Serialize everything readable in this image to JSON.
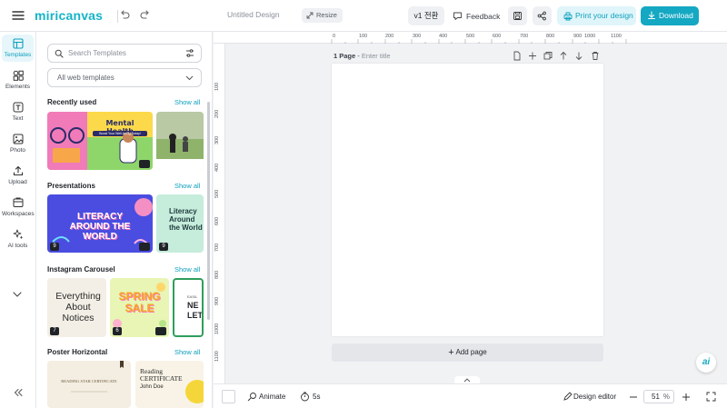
{
  "topbar": {
    "logo": "miricanvas",
    "title": "Untitled Design",
    "resize": "Resize",
    "version": "v1 전환",
    "feedback": "Feedback",
    "print": "Print your design",
    "download": "Download"
  },
  "rail": {
    "items": [
      {
        "label": "Templates",
        "icon": "templates-icon"
      },
      {
        "label": "Elements",
        "icon": "elements-icon"
      },
      {
        "label": "Text",
        "icon": "text-icon"
      },
      {
        "label": "Photo",
        "icon": "photo-icon"
      },
      {
        "label": "Upload",
        "icon": "upload-icon"
      },
      {
        "label": "Workspaces",
        "icon": "workspaces-icon"
      },
      {
        "label": "AI tools",
        "icon": "ai-tools-icon"
      }
    ]
  },
  "panel": {
    "search_placeholder": "Search Templates",
    "filter_value": "All web templates",
    "sections": [
      {
        "title": "Recently used",
        "show_all": "Show all",
        "thumbs": [
          {
            "title": "Mental Health",
            "subtitle": "Boost Your Well-being Today!"
          },
          {
            "title": ""
          }
        ]
      },
      {
        "title": "Presentations",
        "show_all": "Show all",
        "thumbs": [
          {
            "title": "LITERACY AROUND THE WORLD",
            "count": "9"
          },
          {
            "title": "Literacy Around the World",
            "count": "9"
          }
        ]
      },
      {
        "title": "Instagram Carousel",
        "show_all": "Show all",
        "thumbs": [
          {
            "title": "Everything About Notices",
            "count": "7"
          },
          {
            "title": "SPRING SALE",
            "count": "6"
          },
          {
            "title": "NE LETT",
            "sub": "EASIL"
          }
        ]
      },
      {
        "title": "Poster Horizontal",
        "show_all": "Show all",
        "thumbs": [
          {
            "title": "READING STAR CERTIFICATE"
          },
          {
            "title": "Reading CERTIFICATE",
            "name": "John Doe"
          }
        ]
      }
    ]
  },
  "canvas": {
    "page_label": "1 Page",
    "page_title_placeholder": "Enter title",
    "add_page": "Add page",
    "ruler_top": [
      "100",
      "200",
      "300",
      "400",
      "500",
      "600",
      "700",
      "800",
      "900",
      "1000",
      "1100"
    ],
    "ruler_top_zero": "0",
    "ruler_left": [
      "100",
      "200",
      "300",
      "400",
      "500",
      "600",
      "700",
      "800",
      "900",
      "1000",
      "1100"
    ],
    "ai_label": "ai"
  },
  "bottombar": {
    "animate": "Animate",
    "duration": "5s",
    "design_editor": "Design editor",
    "zoom_value": "51",
    "zoom_unit": "%"
  }
}
